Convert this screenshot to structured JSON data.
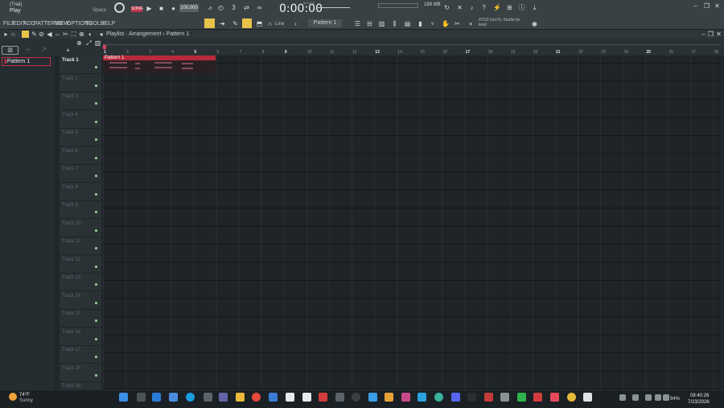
{
  "title": {
    "mode": "(Trial)",
    "action": "Play",
    "shortcut": "Space"
  },
  "transport": {
    "pat_song": "SONG",
    "tempo": "100.000",
    "time": "0:00:00",
    "time_unit": "M:S:CS",
    "memory": "189 MB"
  },
  "menu": [
    "FILE",
    "EDIT",
    "ADD",
    "PATTERNS",
    "VIEW",
    "OPTIONS",
    "TOOLS",
    "HELP"
  ],
  "tool_mode": "Line",
  "pattern_selector": "Pattern 1",
  "hint": {
    "date": "07/23",
    "text": "Get FL Studio for less!"
  },
  "playlist": {
    "breadcrumb": "Playlist · Arrangement › Pattern 1",
    "pattern_list": [
      "Pattern 1"
    ],
    "clip_label": "Pattern 1",
    "ruler": [
      "1",
      "2",
      "3",
      "4",
      "5",
      "6",
      "7",
      "8",
      "9",
      "10",
      "11",
      "12",
      "13",
      "14",
      "15",
      "16",
      "17",
      "18",
      "19",
      "20",
      "21",
      "22",
      "23",
      "24",
      "25",
      "26",
      "27",
      "28"
    ],
    "tracks": [
      "Track 1",
      "Track 2",
      "Track 3",
      "Track 4",
      "Track 5",
      "Track 6",
      "Track 7",
      "Track 8",
      "Track 9",
      "Track 10",
      "Track 11",
      "Track 12",
      "Track 13",
      "Track 14",
      "Track 15",
      "Track 16",
      "Track 17",
      "Track 18",
      "Track 19"
    ]
  },
  "taskbar": {
    "weather_temp": "74°F",
    "weather_text": "Sunny",
    "battery": "94%",
    "time": "08:40:26",
    "date": "7/23/2026"
  },
  "colors": {
    "clip": "#b82a3a",
    "accent": "#e7c34a",
    "grid": "#1e2428"
  }
}
